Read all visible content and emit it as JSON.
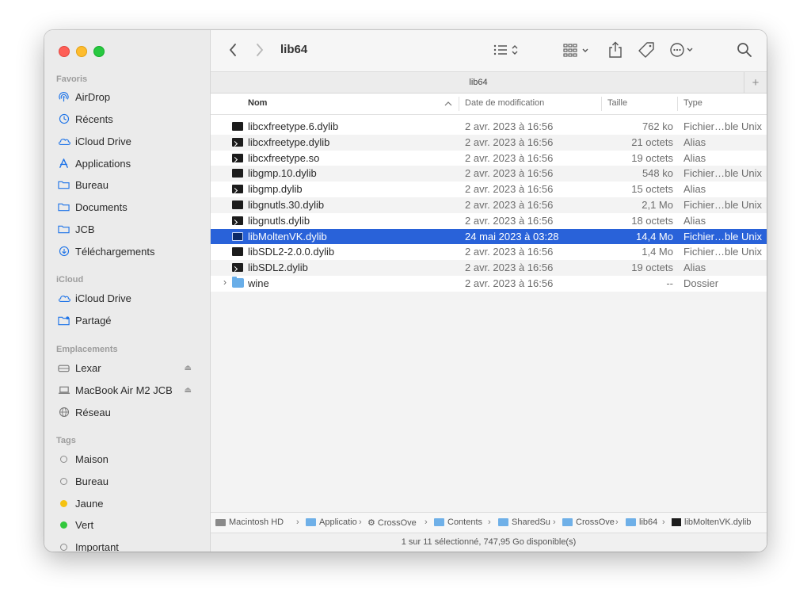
{
  "window": {
    "title": "lib64"
  },
  "toolbar": {
    "back_icon": "chevron-left-icon",
    "forward_icon": "chevron-right-icon",
    "title": "lib64",
    "view_icon": "list-view-icon",
    "group_icon": "grid-group-icon",
    "share_icon": "share-icon",
    "tag_icon": "tag-icon",
    "more_icon": "ellipsis-circle-icon",
    "search_icon": "search-icon"
  },
  "tab": {
    "label": "lib64",
    "plus": "+"
  },
  "sidebar": {
    "favorites_title": "Favoris",
    "favorites": [
      {
        "label": "AirDrop",
        "icon": "airdrop-icon"
      },
      {
        "label": "Récents",
        "icon": "clock-icon"
      },
      {
        "label": "iCloud Drive",
        "icon": "cloud-icon"
      },
      {
        "label": "Applications",
        "icon": "applications-icon"
      },
      {
        "label": "Bureau",
        "icon": "folder-icon"
      },
      {
        "label": "Documents",
        "icon": "folder-icon"
      },
      {
        "label": "JCB",
        "icon": "folder-icon"
      },
      {
        "label": "Téléchargements",
        "icon": "download-icon"
      }
    ],
    "icloud_title": "iCloud",
    "icloud": [
      {
        "label": "iCloud Drive",
        "icon": "cloud-icon"
      },
      {
        "label": "Partagé",
        "icon": "shared-folder-icon"
      }
    ],
    "locations_title": "Emplacements",
    "locations": [
      {
        "label": "Lexar",
        "icon": "drive-icon",
        "eject": true
      },
      {
        "label": "MacBook Air M2 JCB",
        "icon": "laptop-icon",
        "eject": true
      },
      {
        "label": "Réseau",
        "icon": "globe-icon",
        "eject": false
      }
    ],
    "tags_title": "Tags",
    "tags": [
      {
        "label": "Maison",
        "color": ""
      },
      {
        "label": "Bureau",
        "color": ""
      },
      {
        "label": "Jaune",
        "color": "#f5c211"
      },
      {
        "label": "Vert",
        "color": "#32c83c"
      },
      {
        "label": "Important",
        "color": ""
      }
    ]
  },
  "columns": {
    "name": "Nom",
    "date": "Date de modification",
    "size": "Taille",
    "kind": "Type"
  },
  "files": [
    {
      "name": "libcxfreetype.6.dylib",
      "date": "2 avr. 2023 à 16:56",
      "size": "762 ko",
      "kind": "Fichier…ble Unix",
      "icon": "exec",
      "selected": false
    },
    {
      "name": "libcxfreetype.dylib",
      "date": "2 avr. 2023 à 16:56",
      "size": "21 octets",
      "kind": "Alias",
      "icon": "alias",
      "selected": false
    },
    {
      "name": "libcxfreetype.so",
      "date": "2 avr. 2023 à 16:56",
      "size": "19 octets",
      "kind": "Alias",
      "icon": "alias",
      "selected": false
    },
    {
      "name": "libgmp.10.dylib",
      "date": "2 avr. 2023 à 16:56",
      "size": "548 ko",
      "kind": "Fichier…ble Unix",
      "icon": "exec",
      "selected": false
    },
    {
      "name": "libgmp.dylib",
      "date": "2 avr. 2023 à 16:56",
      "size": "15 octets",
      "kind": "Alias",
      "icon": "alias",
      "selected": false
    },
    {
      "name": "libgnutls.30.dylib",
      "date": "2 avr. 2023 à 16:56",
      "size": "2,1 Mo",
      "kind": "Fichier…ble Unix",
      "icon": "exec",
      "selected": false
    },
    {
      "name": "libgnutls.dylib",
      "date": "2 avr. 2023 à 16:56",
      "size": "18 octets",
      "kind": "Alias",
      "icon": "alias",
      "selected": false
    },
    {
      "name": "libMoltenVK.dylib",
      "date": "24 mai 2023 à 03:28",
      "size": "14,4 Mo",
      "kind": "Fichier…ble Unix",
      "icon": "exec",
      "selected": true
    },
    {
      "name": "libSDL2-2.0.0.dylib",
      "date": "2 avr. 2023 à 16:56",
      "size": "1,4 Mo",
      "kind": "Fichier…ble Unix",
      "icon": "exec",
      "selected": false
    },
    {
      "name": "libSDL2.dylib",
      "date": "2 avr. 2023 à 16:56",
      "size": "19 octets",
      "kind": "Alias",
      "icon": "alias",
      "selected": false
    },
    {
      "name": "wine",
      "date": "2 avr. 2023 à 16:56",
      "size": "--",
      "kind": "Dossier",
      "icon": "folder",
      "selected": false
    }
  ],
  "pathbar": [
    {
      "label": "Macintosh HD",
      "icon": "disk"
    },
    {
      "label": "Applicatio",
      "icon": "folder"
    },
    {
      "label": "CrossOve",
      "icon": "gear"
    },
    {
      "label": "Contents",
      "icon": "folder"
    },
    {
      "label": "SharedSu",
      "icon": "folder"
    },
    {
      "label": "CrossOve",
      "icon": "folder"
    },
    {
      "label": "lib64",
      "icon": "folder"
    },
    {
      "label": "libMoltenVK.dylib",
      "icon": "file"
    }
  ],
  "pathbar_separator": "›",
  "status": "1 sur 11 sélectionné, 747,95 Go disponible(s)"
}
